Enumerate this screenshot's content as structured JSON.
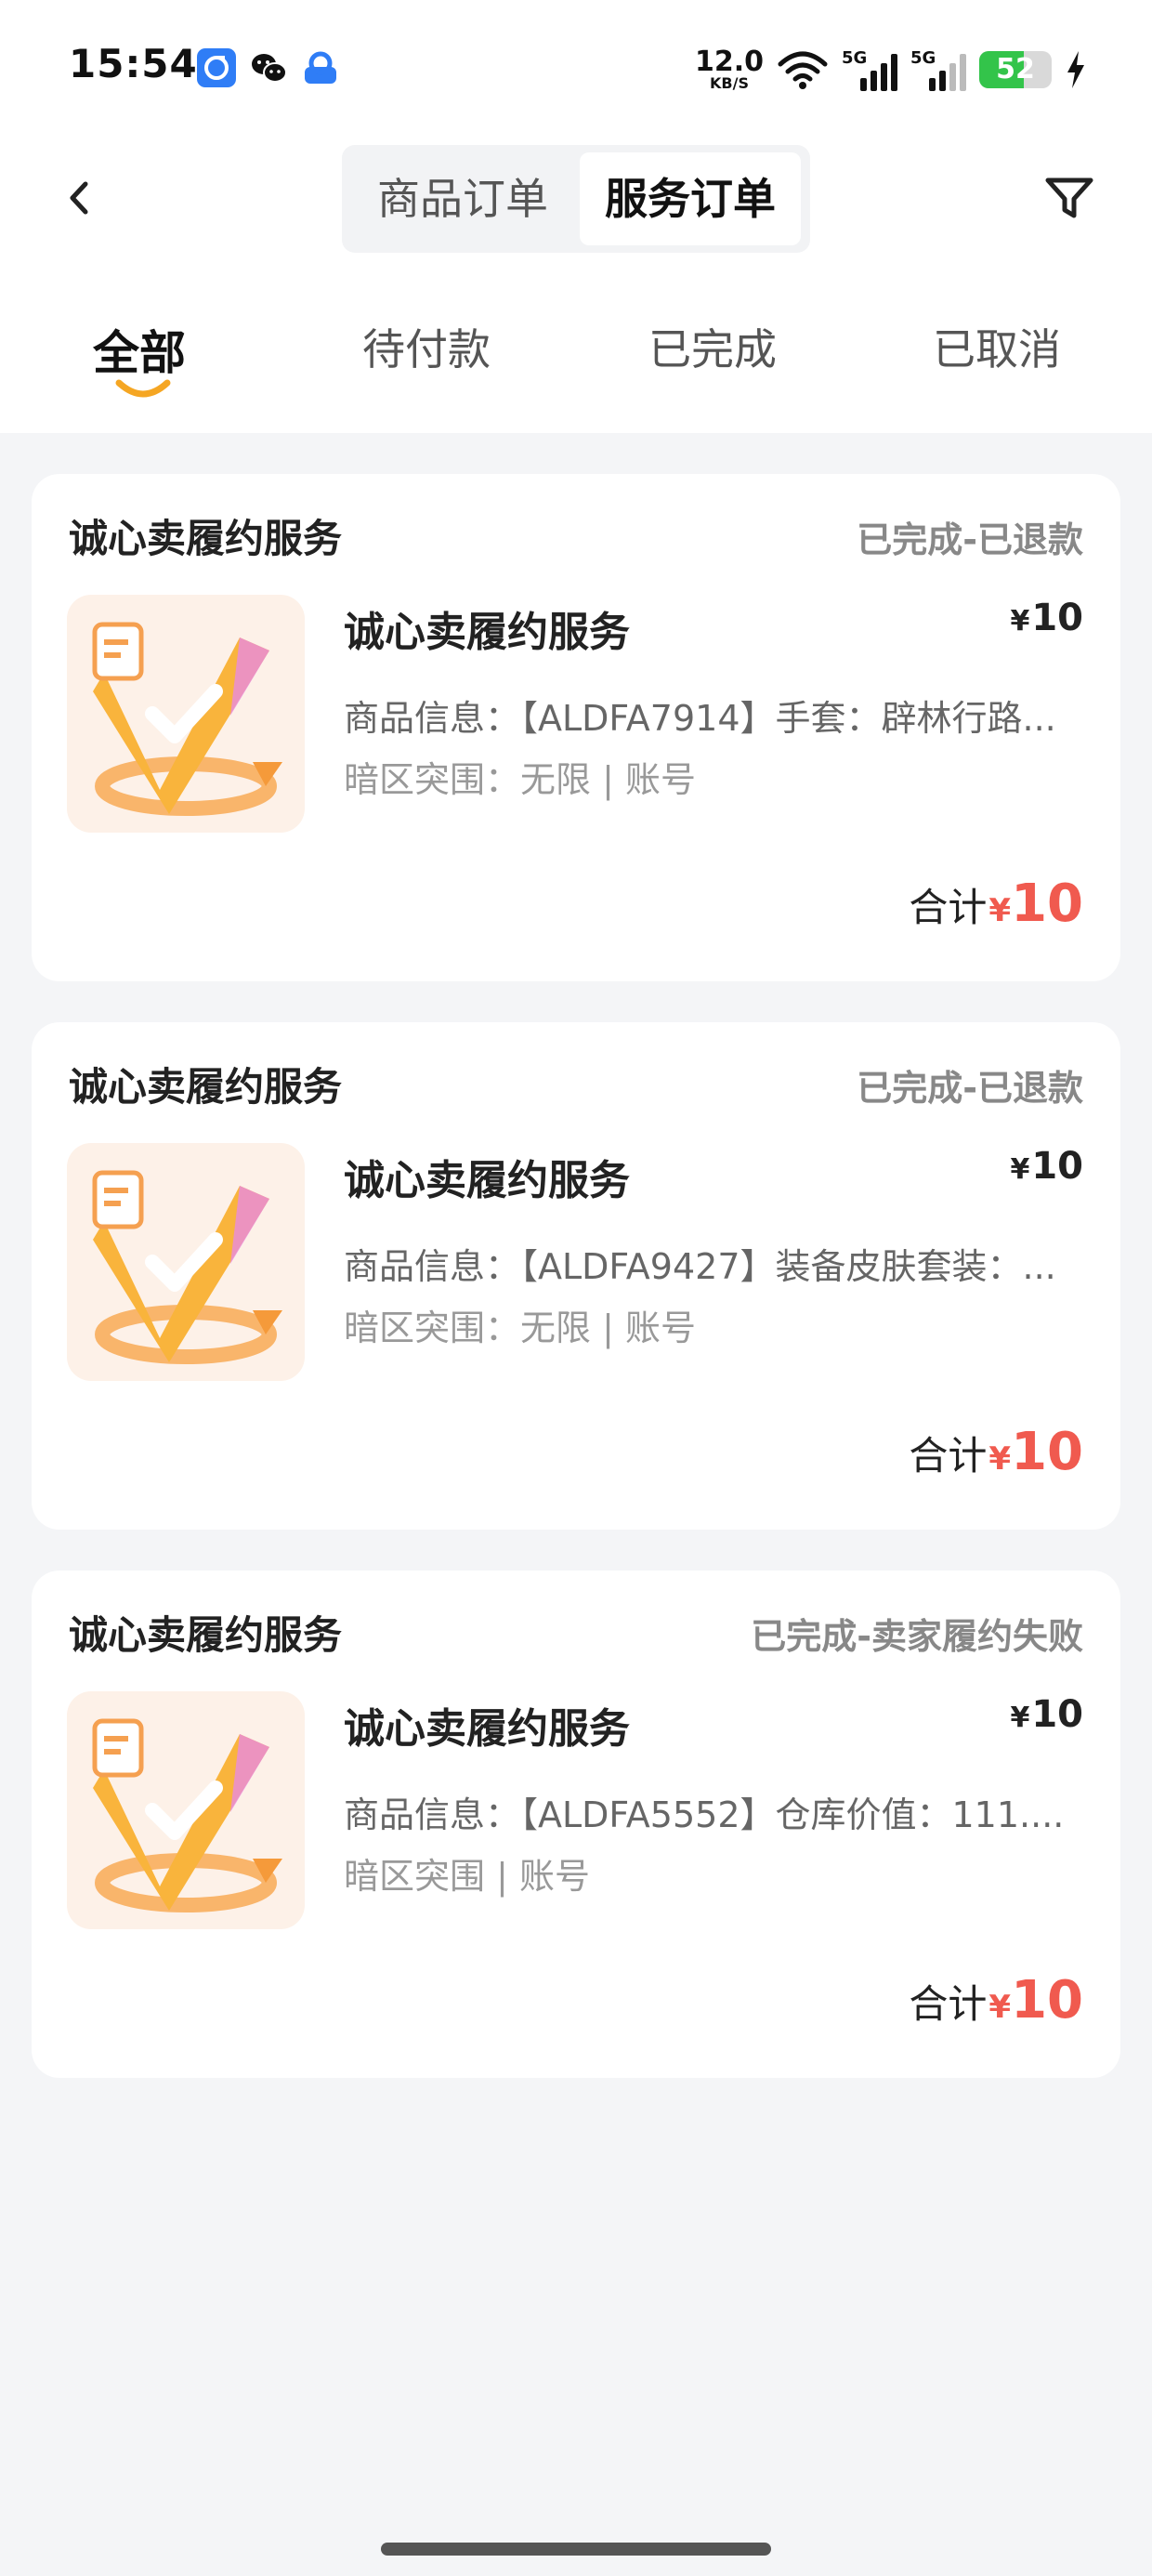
{
  "status_bar": {
    "time": "15:54",
    "net_speed_value": "12.0",
    "net_speed_unit": "KB/S",
    "signal1_label": "5G",
    "signal2_label": "5G",
    "battery_level": "52",
    "icons": [
      "app-blue-icon",
      "wechat-icon",
      "app-shield-icon",
      "wifi-icon",
      "signal-icon",
      "battery-icon",
      "charging-icon"
    ]
  },
  "header": {
    "segments": [
      "商品订单",
      "服务订单"
    ],
    "active_segment": 1,
    "back_icon": "chevron-left-icon",
    "filter_icon": "filter-icon"
  },
  "tabs": [
    "全部",
    "待付款",
    "已完成",
    "已取消"
  ],
  "active_tab": 0,
  "colors": {
    "accent": "#f5a623",
    "price_red": "#f05a4f",
    "background": "#f4f5f7"
  },
  "orders": [
    {
      "shop": "诚心卖履约服务",
      "status": "已完成-已退款",
      "title": "诚心卖履约服务",
      "price_symbol": "¥",
      "price": "10",
      "info": "商品信息：【ALDFA7914】手套：辟林行路...",
      "sub": "暗区突围：无限 | 账号",
      "total_label": "合计",
      "total_symbol": "¥",
      "total": "10"
    },
    {
      "shop": "诚心卖履约服务",
      "status": "已完成-已退款",
      "title": "诚心卖履约服务",
      "price_symbol": "¥",
      "price": "10",
      "info": "商品信息：【ALDFA9427】装备皮肤套装：...",
      "sub": "暗区突围：无限 | 账号",
      "total_label": "合计",
      "total_symbol": "¥",
      "total": "10"
    },
    {
      "shop": "诚心卖履约服务",
      "status": "已完成-卖家履约失败",
      "title": "诚心卖履约服务",
      "price_symbol": "¥",
      "price": "10",
      "info": "商品信息：【ALDFA5552】仓库价值：111....",
      "sub": "暗区突围 | 账号",
      "total_label": "合计",
      "total_symbol": "¥",
      "total": "10"
    }
  ]
}
